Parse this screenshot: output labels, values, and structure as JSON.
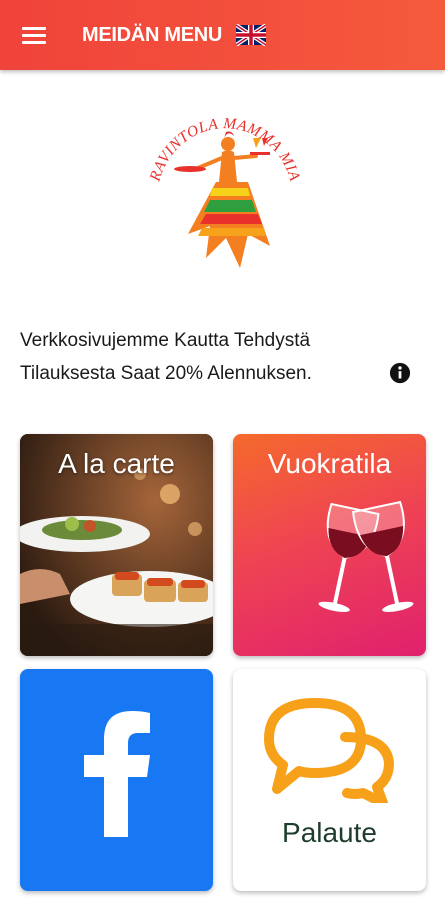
{
  "appbar": {
    "title": "MEIDÄN MENU",
    "menu_icon": "hamburger-menu-icon",
    "language_flag": "uk-flag-icon"
  },
  "logo": {
    "text": "RAVINTOLA MAMMA MIA",
    "colors": [
      "#e8312b",
      "#f7a21b",
      "#2f9e3e"
    ]
  },
  "promo": {
    "text": "Verkkosivujemme Kautta Tehdystä Tilauksesta Saat 20% Alennuksen.",
    "icon": "info-icon"
  },
  "tiles": [
    {
      "label": "A la carte",
      "icon": "food-photo"
    },
    {
      "label": "Vuokratila",
      "icon": "wine-glasses-icon"
    },
    {
      "label": "",
      "icon": "facebook-icon"
    },
    {
      "label": "Palaute",
      "icon": "chat-bubbles-icon"
    }
  ],
  "colors": {
    "appbar": "#f0433a",
    "facebook": "#1877f2",
    "feedback_icon": "#f7a11a",
    "feedback_text": "#1e3d2c"
  }
}
